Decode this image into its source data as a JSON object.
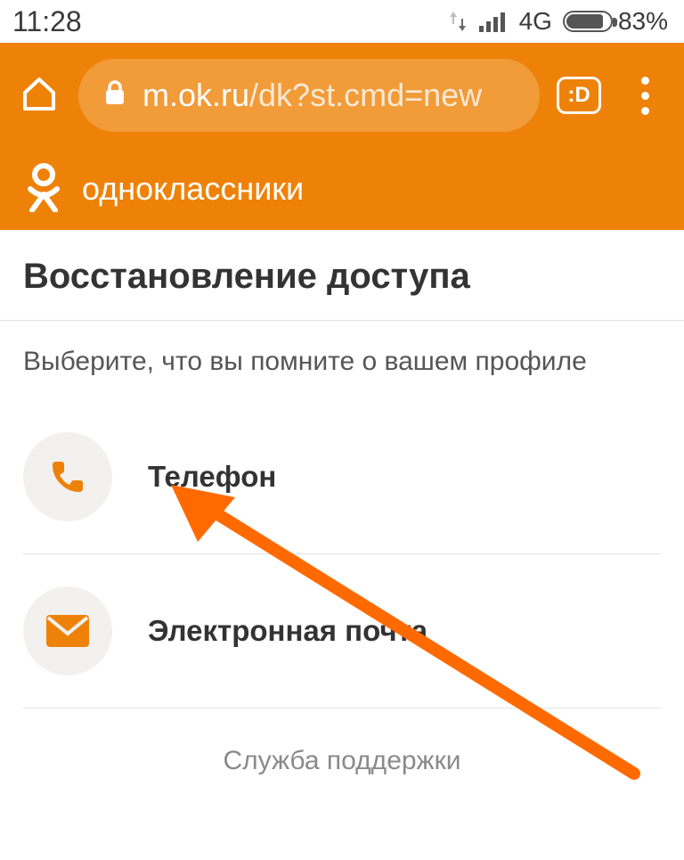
{
  "status_bar": {
    "time": "11:28",
    "network_label": "4G",
    "battery_percent": "83%"
  },
  "browser": {
    "url_domain": "m.ok.ru",
    "url_path": "/dk?st.cmd=new",
    "tab_indicator": ":D"
  },
  "site": {
    "name": "одноклассники"
  },
  "page": {
    "title": "Восстановление доступа",
    "subtitle": "Выберите, что вы помните о вашем профиле",
    "options": [
      {
        "label": "Телефон"
      },
      {
        "label": "Электронная почта"
      }
    ],
    "support_link": "Служба поддержки"
  }
}
